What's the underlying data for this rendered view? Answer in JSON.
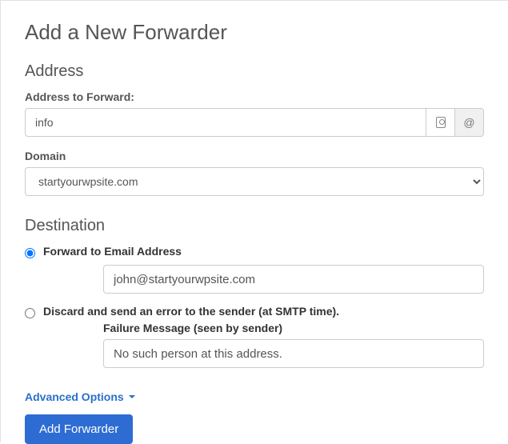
{
  "page": {
    "title": "Add a New Forwarder"
  },
  "address": {
    "heading": "Address",
    "label": "Address to Forward:",
    "value": "info",
    "at_symbol": "@",
    "domain_label": "Domain",
    "domain_value": "startyourwpsite.com"
  },
  "destination": {
    "heading": "Destination",
    "option_forward": {
      "label": "Forward to Email Address",
      "value": "john@startyourwpsite.com",
      "selected": true
    },
    "option_discard": {
      "label": "Discard and send an error to the sender (at SMTP time).",
      "sublabel": "Failure Message (seen by sender)",
      "value": "No such person at this address.",
      "selected": false
    }
  },
  "advanced": {
    "label": "Advanced Options"
  },
  "submit": {
    "label": "Add Forwarder"
  }
}
